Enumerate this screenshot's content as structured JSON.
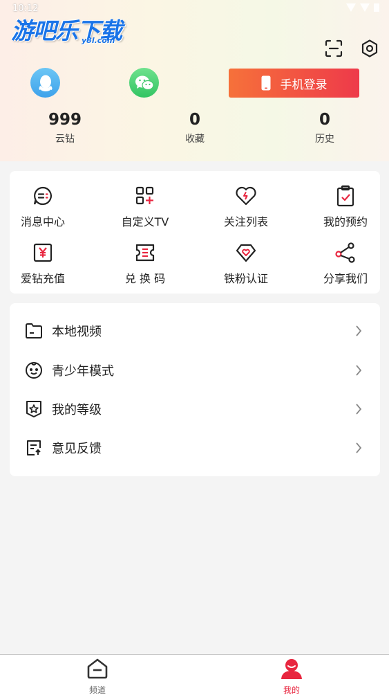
{
  "status_bar": {
    "time": "10:12"
  },
  "brand": {
    "logo_text": "游吧乐下载",
    "logo_sub": "y8l.com"
  },
  "header": {
    "scan_icon": "scan-icon",
    "settings_icon": "settings-icon"
  },
  "login": {
    "qq_icon": "qq-icon",
    "wechat_icon": "wechat-icon",
    "phone_login_label": "手机登录",
    "accent_start": "#f6713a",
    "accent_end": "#ee3a4a"
  },
  "stats": [
    {
      "value": "999",
      "label": "云钻"
    },
    {
      "value": "0",
      "label": "收藏"
    },
    {
      "value": "0",
      "label": "历史"
    }
  ],
  "grid": [
    {
      "label": "消息中心",
      "icon": "message-icon"
    },
    {
      "label": "自定义TV",
      "icon": "custom-grid-icon"
    },
    {
      "label": "关注列表",
      "icon": "heart-icon"
    },
    {
      "label": "我的预约",
      "icon": "clipboard-check-icon"
    },
    {
      "label": "爱钻充值",
      "icon": "yen-icon"
    },
    {
      "label": "兑 换 码",
      "icon": "ticket-icon"
    },
    {
      "label": "铁粉认证",
      "icon": "diamond-heart-icon"
    },
    {
      "label": "分享我们",
      "icon": "share-icon"
    }
  ],
  "menu": [
    {
      "label": "本地视频",
      "icon": "folder-icon"
    },
    {
      "label": "青少年模式",
      "icon": "child-face-icon"
    },
    {
      "label": "我的等级",
      "icon": "level-star-icon"
    },
    {
      "label": "意见反馈",
      "icon": "feedback-icon"
    }
  ],
  "bottom_nav": [
    {
      "label": "频道",
      "icon": "home-icon",
      "active": false
    },
    {
      "label": "我的",
      "icon": "user-icon",
      "active": true
    }
  ],
  "colors": {
    "active_tab": "#e8263f",
    "icon_red": "#e8263f",
    "icon_dark": "#222222"
  }
}
